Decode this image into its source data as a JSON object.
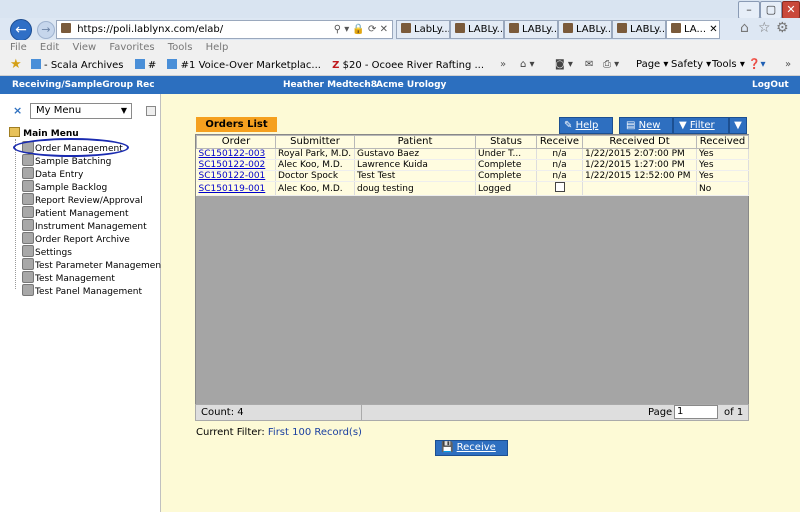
{
  "browser": {
    "url": "https://poli.lablynx.com/elab/",
    "tabs": [
      {
        "label": "LabLy..."
      },
      {
        "label": "LABLy..."
      },
      {
        "label": "LABLy..."
      },
      {
        "label": "LABLy..."
      },
      {
        "label": "LABLy..."
      },
      {
        "label": "LA..."
      }
    ],
    "menu": [
      "File",
      "Edit",
      "View",
      "Favorites",
      "Tools",
      "Help"
    ],
    "favorites": [
      {
        "label": "- Scala Archives"
      },
      {
        "label": "#"
      },
      {
        "label": "#1 Voice-Over Marketplac..."
      },
      {
        "label": "$20 - Ocoee River Rafting ..."
      }
    ],
    "commands": {
      "page": "Page",
      "safety": "Safety",
      "tools": "Tools"
    }
  },
  "app": {
    "header_left": "Receiving/SampleGroup Rec",
    "header_user": "Heather Medtech8",
    "header_sep": "-",
    "header_org": "Acme Urology",
    "logout": "LogOut"
  },
  "sidebar": {
    "close": "×",
    "menu_select": "My Menu",
    "root": "Main Menu",
    "items": [
      {
        "label": "Order Management"
      },
      {
        "label": "Sample Batching"
      },
      {
        "label": "Data Entry"
      },
      {
        "label": "Sample Backlog"
      },
      {
        "label": "Report Review/Approval"
      },
      {
        "label": "Patient Management"
      },
      {
        "label": "Instrument Management"
      },
      {
        "label": "Order Report Archive"
      },
      {
        "label": "Settings"
      },
      {
        "label": "Test Parameter Management"
      },
      {
        "label": "Test Management"
      },
      {
        "label": "Test Panel Management"
      }
    ]
  },
  "orders": {
    "tab_label": "Orders List",
    "buttons": {
      "help": "Help",
      "new": "New",
      "filter": "Filter"
    },
    "columns": [
      "Order",
      "Submitter",
      "Patient",
      "Status",
      "Receive",
      "Received Dt",
      "Received"
    ],
    "rows": [
      {
        "order": "SC150122-003",
        "submitter": "Royal Park, M.D.",
        "patient": "Gustavo Baez",
        "status": "Under T...",
        "receive": "n/a",
        "received_dt": "1/22/2015 2:07:00 PM",
        "received": "Yes"
      },
      {
        "order": "SC150122-002",
        "submitter": "Alec Koo, M.D.",
        "patient": "Lawrence Kuida",
        "status": "Complete",
        "receive": "n/a",
        "received_dt": "1/22/2015 1:27:00 PM",
        "received": "Yes"
      },
      {
        "order": "SC150122-001",
        "submitter": "Doctor Spock",
        "patient": "Test Test",
        "status": "Complete",
        "receive": "n/a",
        "received_dt": "1/22/2015 12:52:00 PM",
        "received": "Yes"
      },
      {
        "order": "SC150119-001",
        "submitter": "Alec Koo, M.D.",
        "patient": "doug testing",
        "status": "Logged",
        "receive": "",
        "received_dt": "",
        "received": "No"
      }
    ],
    "count_label": "Count: 4",
    "page_label": "Page",
    "page_value": "1",
    "page_total": "of 1",
    "filter_label": "Current Filter:",
    "filter_value": "First 100 Record(s)",
    "receive_button": "Receive"
  }
}
